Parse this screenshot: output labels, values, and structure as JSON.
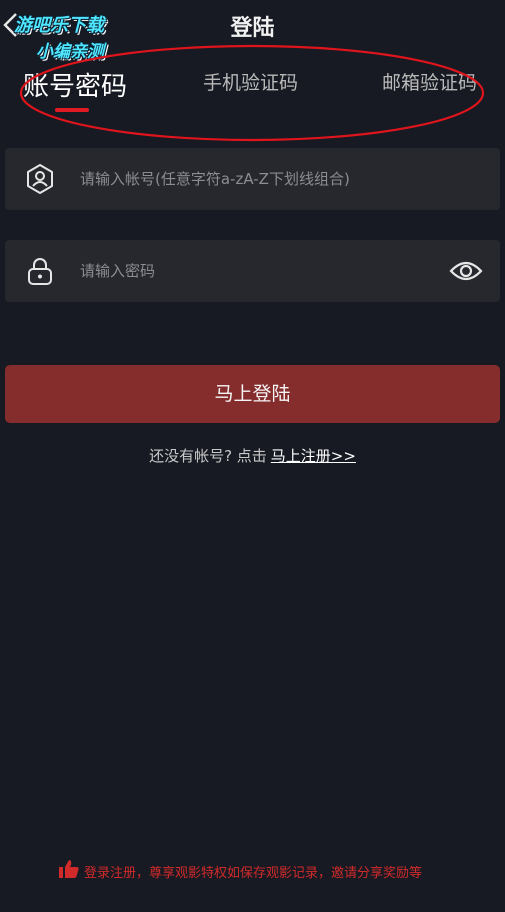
{
  "header": {
    "title": "登陆"
  },
  "watermark": {
    "line1": "游吧乐下载",
    "line2": "小编亲测"
  },
  "tabs": [
    {
      "label": "账号密码",
      "active": true
    },
    {
      "label": "手机验证码",
      "active": false
    },
    {
      "label": "邮箱验证码",
      "active": false
    }
  ],
  "form": {
    "account_placeholder": "请输入帐号(任意字符a-zA-Z下划线组合)",
    "password_placeholder": "请输入密码",
    "submit_label": "马上登陆"
  },
  "register": {
    "prompt": "还没有帐号? 点击",
    "link": "马上注册>>"
  },
  "footer": {
    "note": "登录注册，尊享观影特权如保存观影记录，邀请分享奖励等"
  },
  "colors": {
    "background": "#171a22",
    "field": "#26282d",
    "button": "#852c2d",
    "accent": "#e01b24"
  }
}
